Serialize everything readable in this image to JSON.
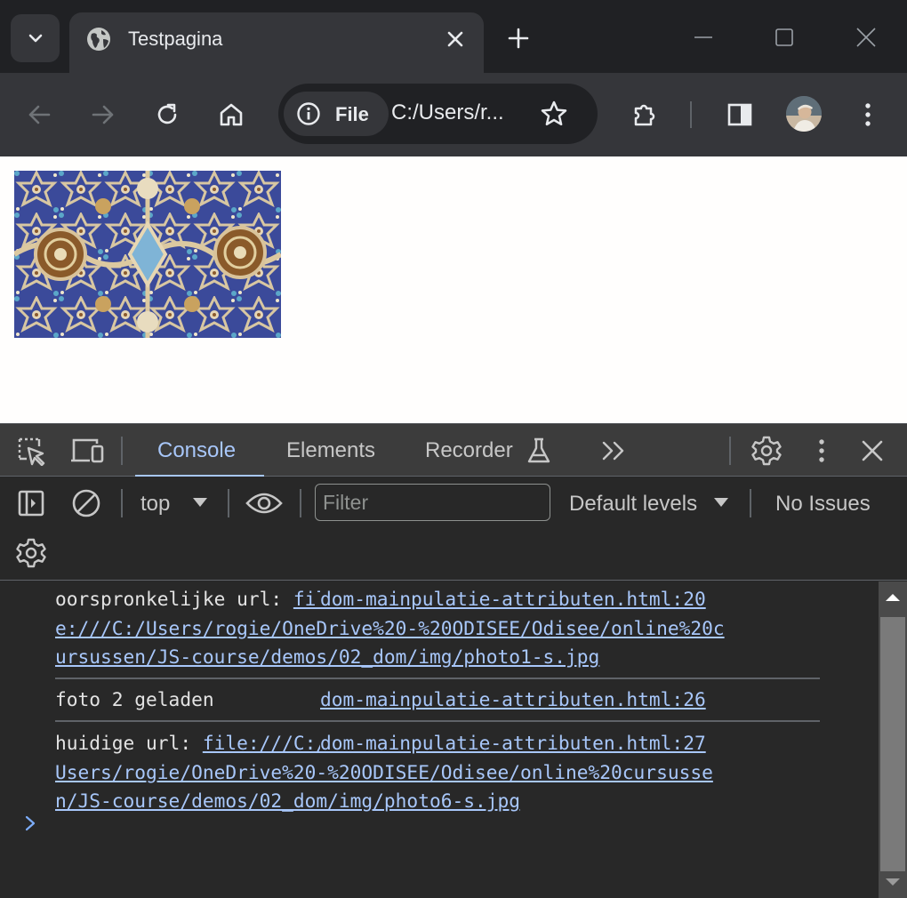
{
  "browser": {
    "tab_title": "Testpagina",
    "site_info_label": "File",
    "url": "C:/Users/r..."
  },
  "devtools": {
    "tabs": [
      "Console",
      "Elements",
      "Recorder"
    ],
    "active_tab": "Console",
    "console_toolbar": {
      "context": "top",
      "filter_placeholder": "Filter",
      "levels": "Default levels",
      "issues": "No Issues"
    },
    "messages": [
      {
        "text": "oorspronkelijke url: ",
        "link_lines": [
          "fil",
          "e:///C:/Users/rogie/OneDrive%20-%20ODISEE/Odisee/online%20c",
          "ursussen/JS-course/demos/02_dom/img/photo1-s.jpg"
        ],
        "source": "dom-mainpulatie-attributen.html:20"
      },
      {
        "text": "foto 2 geladen",
        "source": "dom-mainpulatie-attributen.html:26"
      },
      {
        "text": "huidige url: ",
        "link_lines": [
          "file:///C:/",
          "Users/rogie/OneDrive%20-%20ODISEE/Odisee/online%20cursusse",
          "n/JS-course/demos/02_dom/img/photo6-s.jpg"
        ],
        "source": "dom-mainpulatie-attributen.html:27"
      }
    ]
  },
  "colors": {
    "chrome_bg": "#202124",
    "toolbar_bg": "#35363a",
    "devtools_bg": "#282828",
    "accent": "#a8c7fa"
  },
  "icons": [
    "chevron-down-icon",
    "globe-icon",
    "close-icon",
    "plus-icon",
    "minimize-icon",
    "maximize-icon",
    "back-icon",
    "forward-icon",
    "reload-icon",
    "home-icon",
    "info-icon",
    "star-icon",
    "extensions-icon",
    "side-panel-icon",
    "avatar",
    "more-vert-icon",
    "inspect-icon",
    "device-icon",
    "flask-icon",
    "more-tabs-icon",
    "settings-icon",
    "sidebar-icon",
    "clear-icon",
    "eye-icon",
    "caret-down-icon",
    "prompt-chevron-icon"
  ]
}
